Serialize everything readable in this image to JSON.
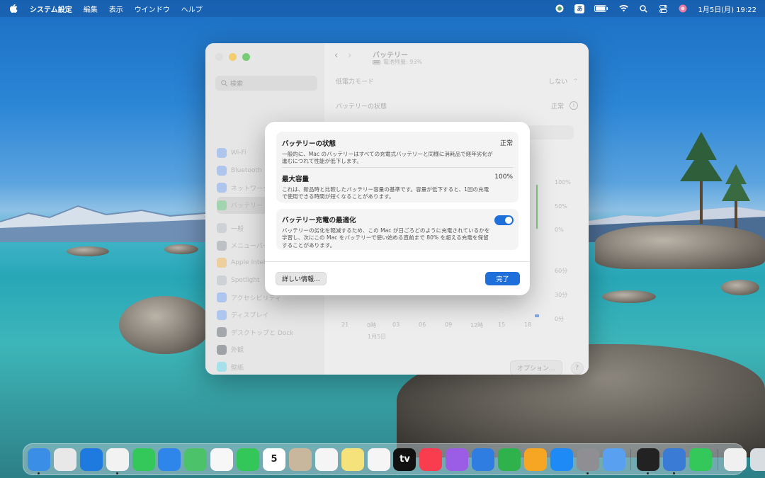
{
  "menubar": {
    "app_name": "システム設定",
    "menus": [
      "編集",
      "表示",
      "ウインドウ",
      "ヘルプ"
    ],
    "ime": "あ",
    "datetime": "1月5日(月)  19:22"
  },
  "window": {
    "search_placeholder": "検索",
    "title": "バッテリー",
    "subtitle": "電池残量: 93%",
    "sidebar_items": [
      {
        "label": "Wi-Fi",
        "color": "#3b82f6"
      },
      {
        "label": "Bluetooth",
        "color": "#3b82f6"
      },
      {
        "label": "ネットワーク",
        "color": "#3b82f6"
      },
      {
        "label": "バッテリー",
        "color": "#34c759"
      },
      {
        "label": "一般",
        "color": "#9ca3af"
      },
      {
        "label": "メニューバー",
        "color": "#6b7280"
      },
      {
        "label": "Apple Intelligence",
        "color": "#f59e0b"
      },
      {
        "label": "Spotlight",
        "color": "#9ca3af"
      },
      {
        "label": "アクセシビリティ",
        "color": "#3b82f6"
      },
      {
        "label": "ディスプレイ",
        "color": "#3b82f6"
      },
      {
        "label": "デスクトップと Dock",
        "color": "#1f2937"
      },
      {
        "label": "外観",
        "color": "#111827"
      },
      {
        "label": "壁紙",
        "color": "#22d3ee"
      }
    ],
    "low_power_label": "低電力モード",
    "low_power_value": "しない",
    "battery_state_label": "バッテリーの状態",
    "battery_state_value": "正常",
    "chart_right_labels": [
      "100%",
      "50%",
      "0%",
      "60分",
      "30分",
      "0分"
    ],
    "chart_x_labels": [
      "21",
      "0時",
      "03",
      "06",
      "09",
      "12時",
      "15",
      "18"
    ],
    "chart_date": "1月5日",
    "options_button": "オプション...",
    "help": "?"
  },
  "modal": {
    "health": {
      "title": "バッテリーの状態",
      "value": "正常",
      "desc": "一般的に、Mac のバッテリーはすべての充電式バッテリーと同様に消耗品で経年劣化が進むにつれて性能が低下します。"
    },
    "capacity": {
      "title": "最大容量",
      "value": "100%",
      "desc": "これは、新品時と比較したバッテリー容量の基準です。容量が低下すると、1回の充電で使用できる時間が短くなることがあります。"
    },
    "optimize": {
      "title": "バッテリー充電の最適化",
      "desc": "バッテリーの劣化を軽減するため、この Mac が日ごろどのように充電されているかを学習し、次にこの Mac をバッテリーで使い始める直前まで 80% を超える充電を保留することがあります。",
      "enabled": true
    },
    "more_info": "詳しい情報...",
    "done": "完了"
  },
  "dock": {
    "apps": [
      {
        "name": "finder",
        "color": "#3a8ee6",
        "dot": true
      },
      {
        "name": "launchpad",
        "color": "#e8e8e8"
      },
      {
        "name": "safari",
        "color": "#1f7ae0"
      },
      {
        "name": "chrome",
        "color": "#f2f2f2",
        "dot": true
      },
      {
        "name": "messages",
        "color": "#34c759"
      },
      {
        "name": "mail",
        "color": "#2f86ea"
      },
      {
        "name": "maps",
        "color": "#4cc36a"
      },
      {
        "name": "photos",
        "color": "#f7f7f7"
      },
      {
        "name": "facetime",
        "color": "#33c759"
      },
      {
        "name": "calendar",
        "color": "#ffffff",
        "glyph": "5"
      },
      {
        "name": "contacts",
        "color": "#c8b79c"
      },
      {
        "name": "reminders",
        "color": "#f5f5f5"
      },
      {
        "name": "notes",
        "color": "#f6e27b"
      },
      {
        "name": "freeform",
        "color": "#f5f5f5"
      },
      {
        "name": "tv",
        "color": "#111111",
        "glyph": "tv"
      },
      {
        "name": "music",
        "color": "#fa3c4f"
      },
      {
        "name": "podcasts",
        "color": "#9b5de5"
      },
      {
        "name": "keynote",
        "color": "#2f7de1"
      },
      {
        "name": "numbers",
        "color": "#2fb14c"
      },
      {
        "name": "pages",
        "color": "#f6a623"
      },
      {
        "name": "app-store",
        "color": "#1d8af5"
      },
      {
        "name": "system-settings",
        "color": "#8e8e93",
        "dot": true
      },
      {
        "name": "iphone-mirroring",
        "color": "#5aa0f0"
      }
    ],
    "recent": [
      {
        "name": "terminal",
        "color": "#222222",
        "dot": true
      },
      {
        "name": "disk-utility",
        "color": "#3a7bd5",
        "dot": true
      },
      {
        "name": "phone",
        "color": "#34c759"
      }
    ],
    "extra": [
      {
        "name": "document",
        "color": "#f0f0f0"
      },
      {
        "name": "trash",
        "color": "#d8dde2"
      }
    ]
  }
}
